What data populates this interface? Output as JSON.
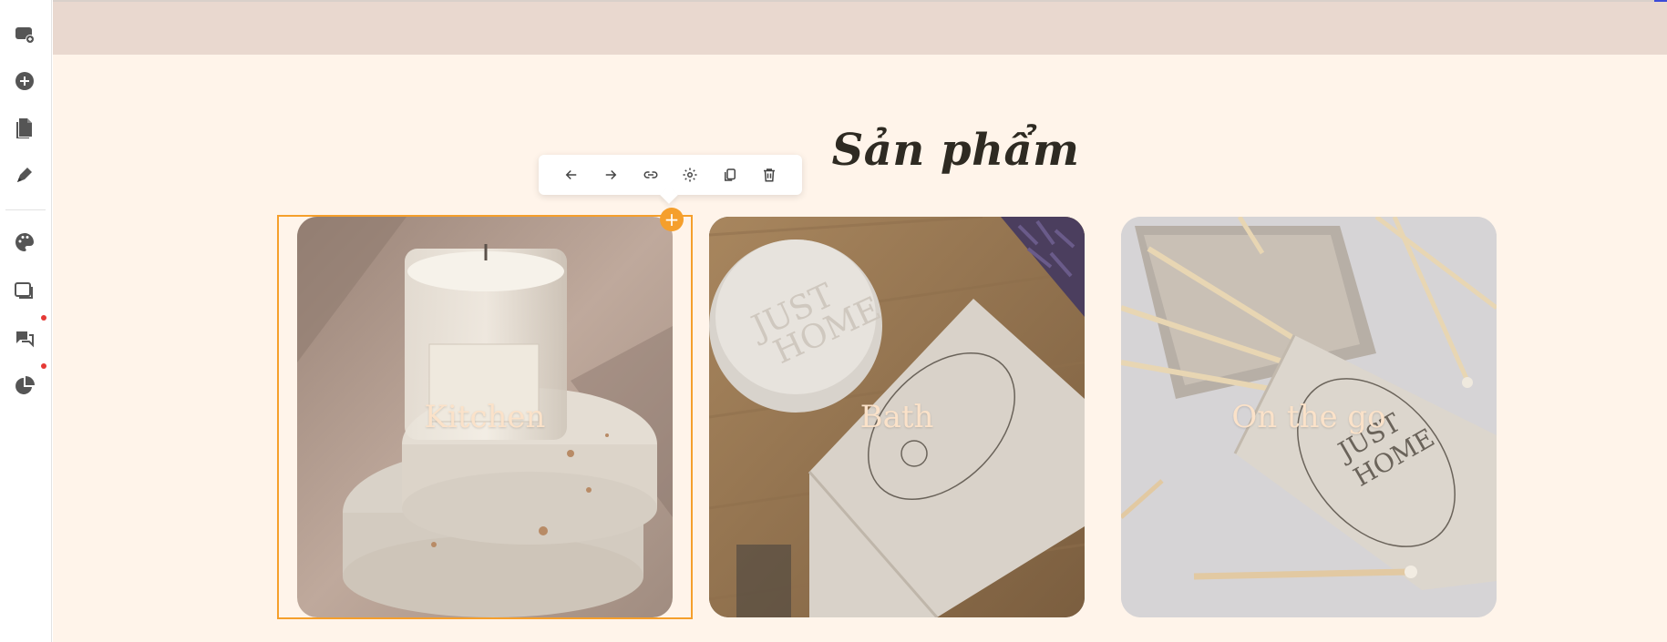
{
  "sidebar": {
    "items": [
      {
        "name": "add-section-icon"
      },
      {
        "name": "add-element-icon"
      },
      {
        "name": "pages-icon"
      },
      {
        "name": "edit-pen-icon"
      },
      {
        "name": "palette-icon"
      },
      {
        "name": "layers-icon"
      },
      {
        "name": "comments-icon",
        "notification": true
      },
      {
        "name": "analytics-pie-icon",
        "notification": true
      }
    ]
  },
  "section": {
    "title": "Sản phẩm"
  },
  "toolbar": {
    "buttons": [
      "arrow-left-icon",
      "arrow-right-icon",
      "link-icon",
      "settings-gear-icon",
      "duplicate-icon",
      "trash-icon"
    ]
  },
  "add_handle": "+",
  "cards": [
    {
      "label": "Kitchen",
      "image": "candle on terrazzo pedestal"
    },
    {
      "label": "Bath",
      "image": "soap bar and box on wooden tray"
    },
    {
      "label": "On the go",
      "image": "matchbox with matches"
    }
  ],
  "colors": {
    "canvas_bg": "#fff4ea",
    "top_band": "#e9d8cf",
    "selection": "#f59f2c",
    "card_label": "#fbe2c9",
    "title": "#2e2a22"
  }
}
